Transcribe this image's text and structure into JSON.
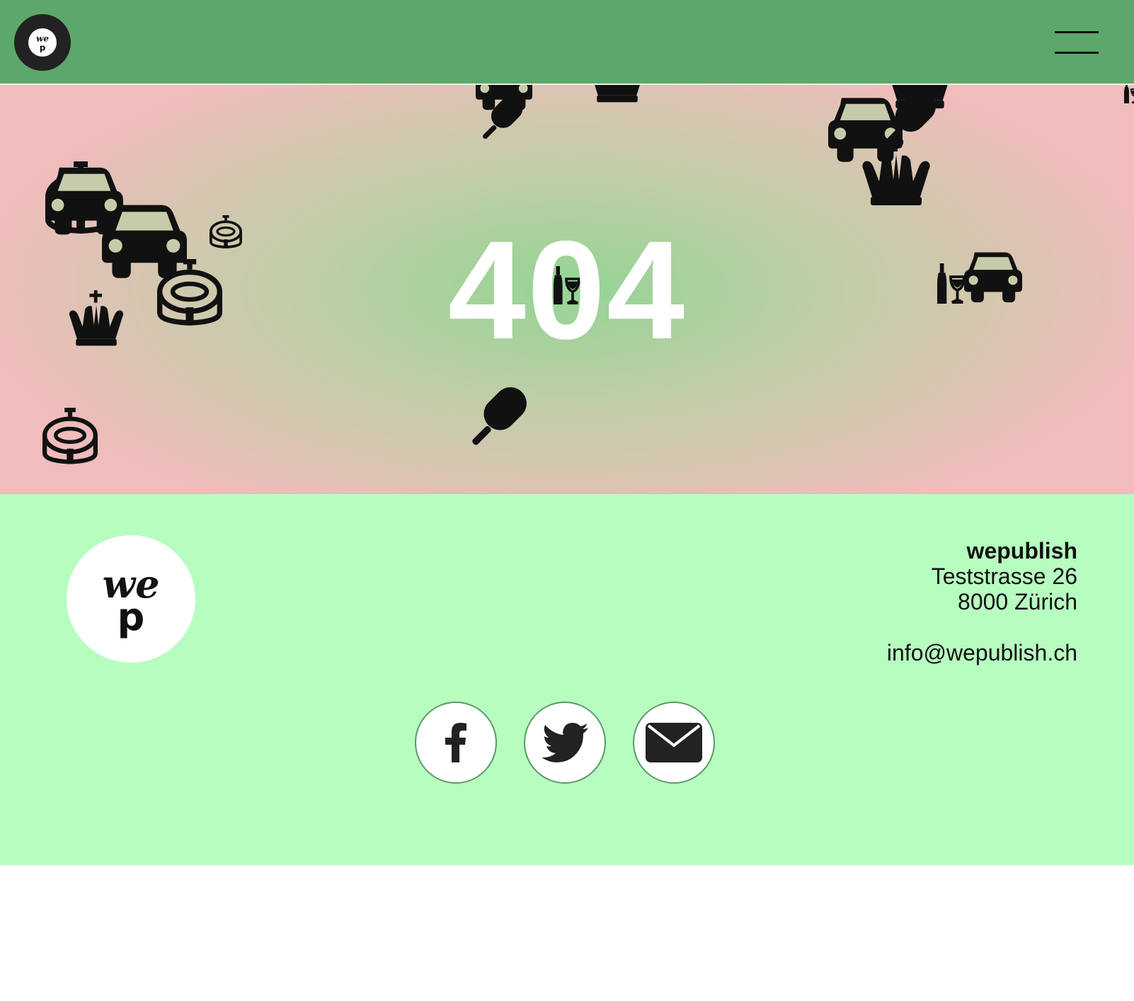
{
  "header": {
    "logo_icon": "wep-logo-icon",
    "menu_icon": "hamburger-menu-icon",
    "background_color": "#5ca86a"
  },
  "hero": {
    "error_code": "404",
    "decorative_icons": [
      "car-icon",
      "crown-icon",
      "stadium-icon",
      "popsicle-icon",
      "wine-bottle-glass-icon"
    ]
  },
  "footer": {
    "background_color": "#b7fdc0",
    "logo_icon": "wep-logo-icon",
    "organization": "wepublish",
    "street": "Teststrasse 26",
    "city": "8000 Zürich",
    "email": "info@wepublish.ch",
    "social": [
      {
        "name": "facebook",
        "icon": "facebook-icon"
      },
      {
        "name": "twitter",
        "icon": "twitter-icon"
      },
      {
        "name": "email",
        "icon": "mail-icon"
      }
    ]
  }
}
